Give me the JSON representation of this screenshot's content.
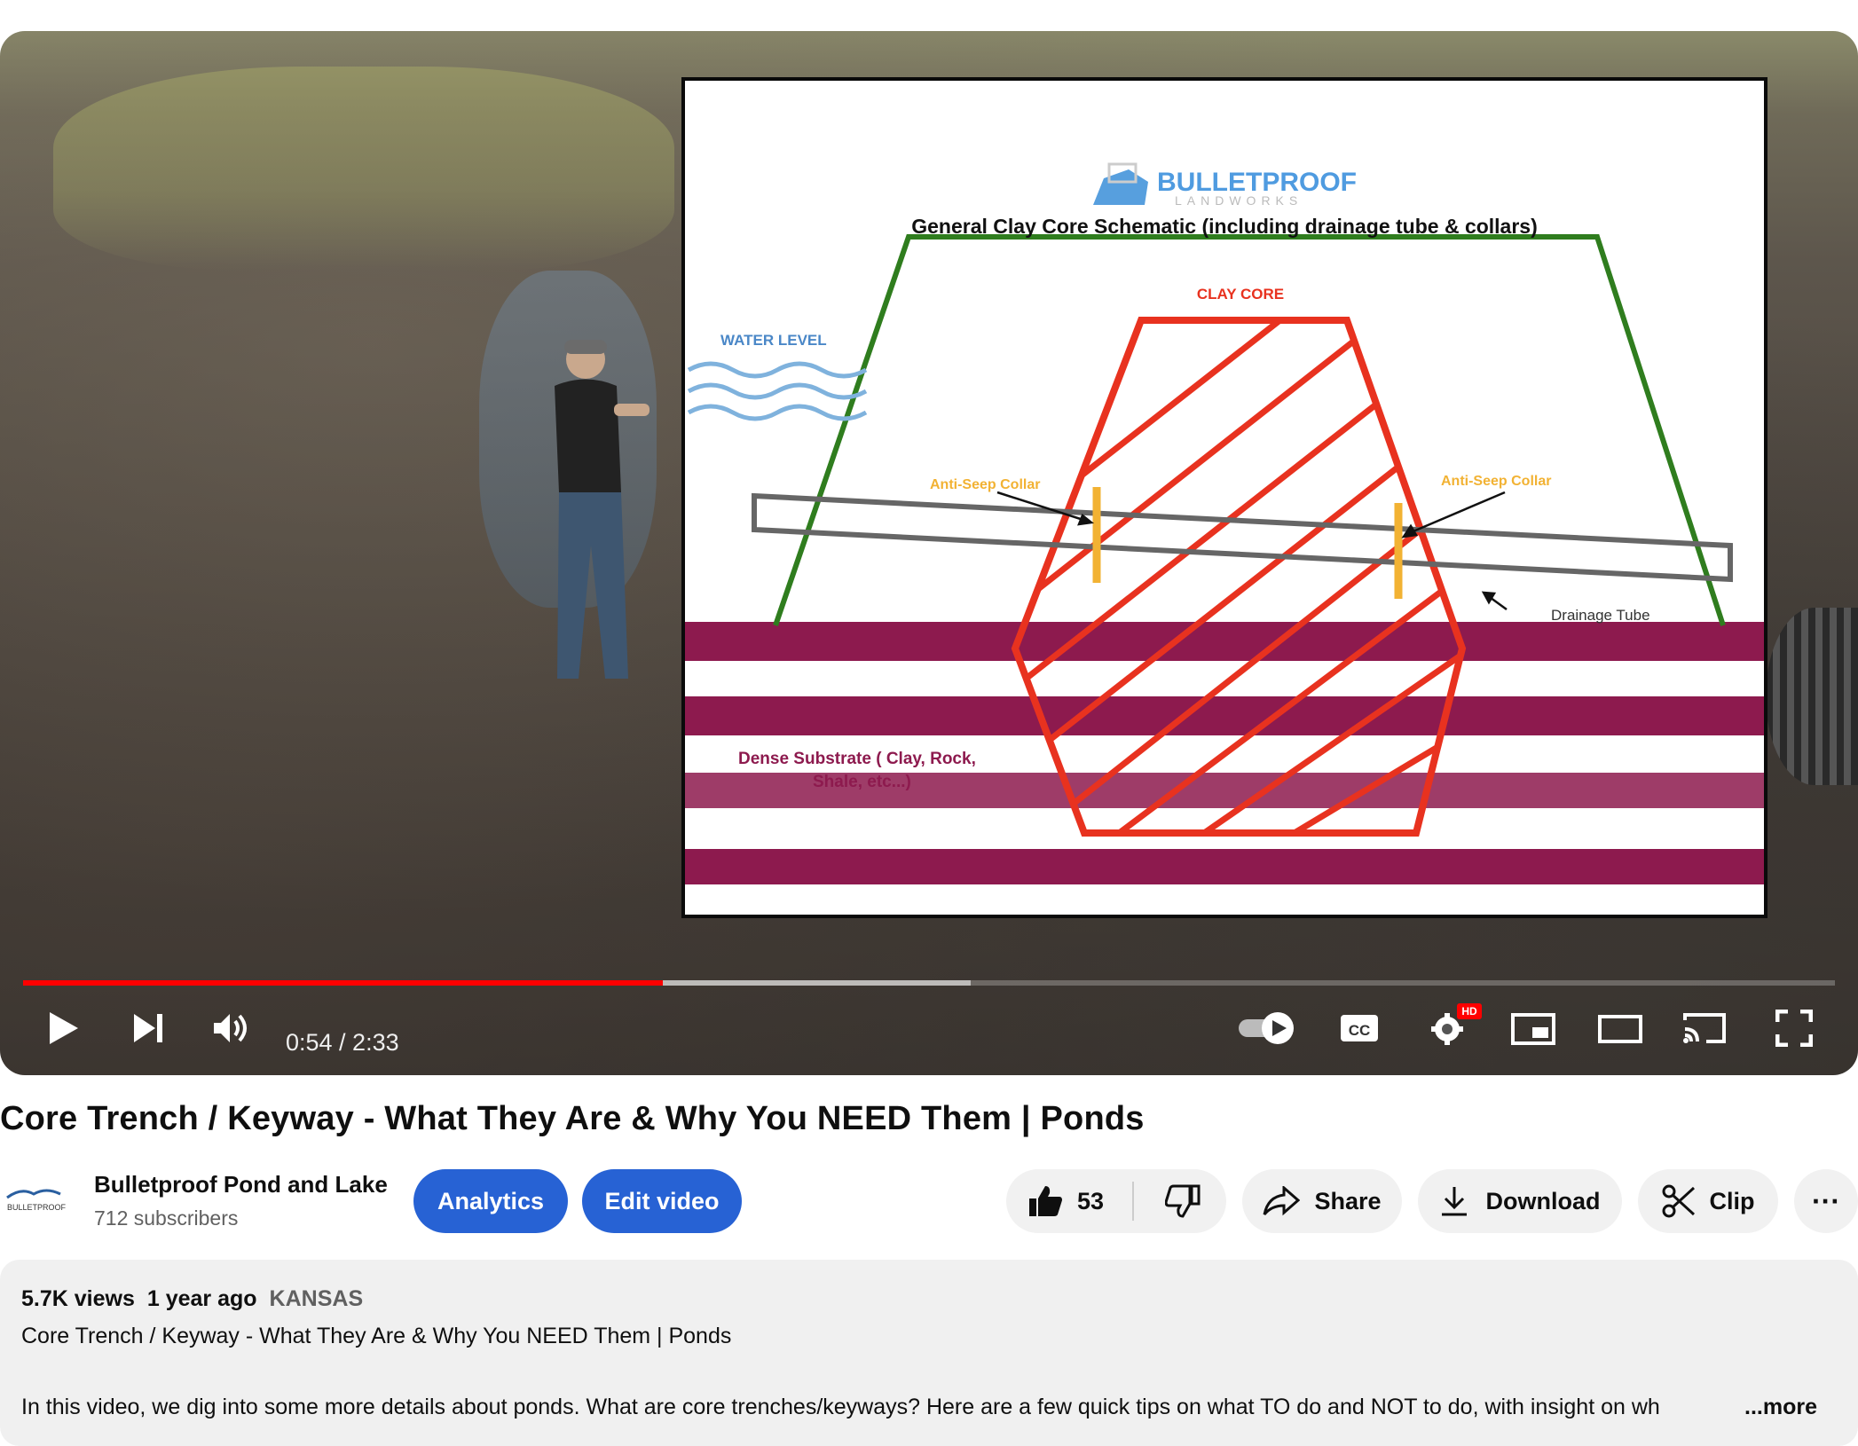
{
  "player": {
    "time_current": "0:54",
    "time_total": "2:33",
    "time_display": "0:54 / 2:33",
    "progress_fraction": 0.353,
    "buffer_fraction": 0.523,
    "hd_badge": "HD",
    "icons": [
      "play-icon",
      "next-icon",
      "volume-icon",
      "autoplay-toggle-icon",
      "cc-icon",
      "settings-icon",
      "miniplayer-icon",
      "theater-icon",
      "cast-icon",
      "fullscreen-icon"
    ]
  },
  "schematic": {
    "logo_text": "BULLETPROOF",
    "logo_sub": "LANDWORKS",
    "title": "General Clay Core Schematic (including drainage tube & collars)",
    "clay_core": "CLAY CORE",
    "water_level": "WATER LEVEL",
    "anti_seep_left": "Anti-Seep Collar",
    "anti_seep_right": "Anti-Seep Collar",
    "drainage_tube": "Drainage Tube",
    "substrate_line1": "Dense Substrate ( Clay, Rock,",
    "substrate_line2": "Shale, etc...)"
  },
  "video": {
    "title": "Core Trench / Keyway - What They Are & Why You NEED Them | Ponds"
  },
  "channel": {
    "name": "Bulletproof Pond and Lake",
    "subscribers": "712 subscribers",
    "logo_text": "BULLETPROOF"
  },
  "actions": {
    "analytics": "Analytics",
    "edit_video": "Edit video",
    "likes": "53",
    "share": "Share",
    "download": "Download",
    "clip": "Clip",
    "more": "···"
  },
  "description": {
    "views": "5.7K views",
    "age": "1 year ago",
    "location": "KANSAS",
    "line1": "Core Trench / Keyway - What They Are & Why You NEED Them  | Ponds",
    "line2": "In this video, we dig into some more details about ponds. What are core trenches/keyways? Here are a few quick tips on what TO do and NOT to do, with insight on wh",
    "more_label": "...more"
  },
  "colors": {
    "accent_blue": "#2762d4",
    "progress_red": "#ff0000",
    "clay_red": "#e8321f",
    "embankment_green": "#2f7d1e",
    "substrate_maroon": "#8d1a4e",
    "water_blue": "#7fb2dd",
    "collar_orange": "#f2b233"
  }
}
